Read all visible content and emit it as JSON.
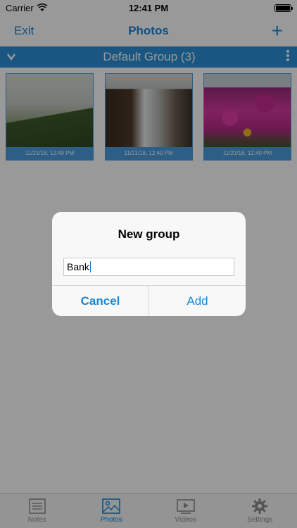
{
  "status_bar": {
    "carrier": "Carrier",
    "time": "12:41 PM"
  },
  "nav": {
    "exit_label": "Exit",
    "title": "Photos",
    "add_label": "+"
  },
  "group": {
    "title": "Default Group (3)"
  },
  "thumbnails": [
    {
      "caption": "11/21/18, 12:40 PM"
    },
    {
      "caption": "11/21/18, 12:40 PM"
    },
    {
      "caption": "11/21/18, 12:40 PM"
    }
  ],
  "dialog": {
    "title": "New group",
    "input_value": "Bank",
    "cancel_label": "Cancel",
    "add_label": "Add"
  },
  "tabs": [
    {
      "label": "Notes",
      "icon": "notes-icon",
      "active": false
    },
    {
      "label": "Photos",
      "icon": "photos-icon",
      "active": true
    },
    {
      "label": "Videos",
      "icon": "videos-icon",
      "active": false
    },
    {
      "label": "Settings",
      "icon": "gear-icon",
      "active": false
    }
  ],
  "colors": {
    "accent": "#1b86d6",
    "header": "#2b8fd8"
  }
}
